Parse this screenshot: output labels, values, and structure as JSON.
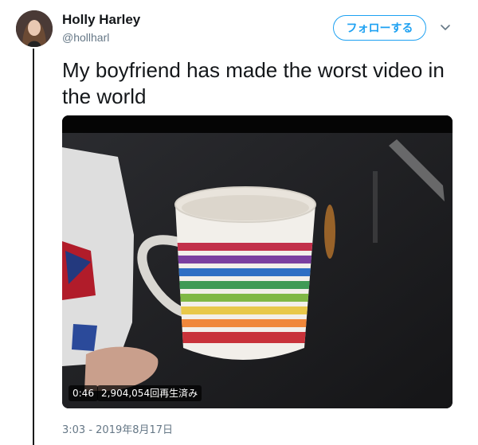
{
  "tweet": {
    "user": {
      "name": "Holly Harley",
      "handle": "@hollharl"
    },
    "follow_label": "フォローする",
    "text": "My boyfriend has made the worst video in the world",
    "media": {
      "duration": "0:46",
      "views": "2,904,054回再生済み",
      "stripe_colors": [
        "#c2304a",
        "#7a3fa0",
        "#2f6fc4",
        "#3f9a55",
        "#7fb845",
        "#e8c84a",
        "#f0873a",
        "#c8323a"
      ]
    },
    "timestamp": "3:03 - 2019年8月17日"
  },
  "colors": {
    "accent": "#1da1f2",
    "text_primary": "#14171a",
    "text_secondary": "#657786"
  }
}
